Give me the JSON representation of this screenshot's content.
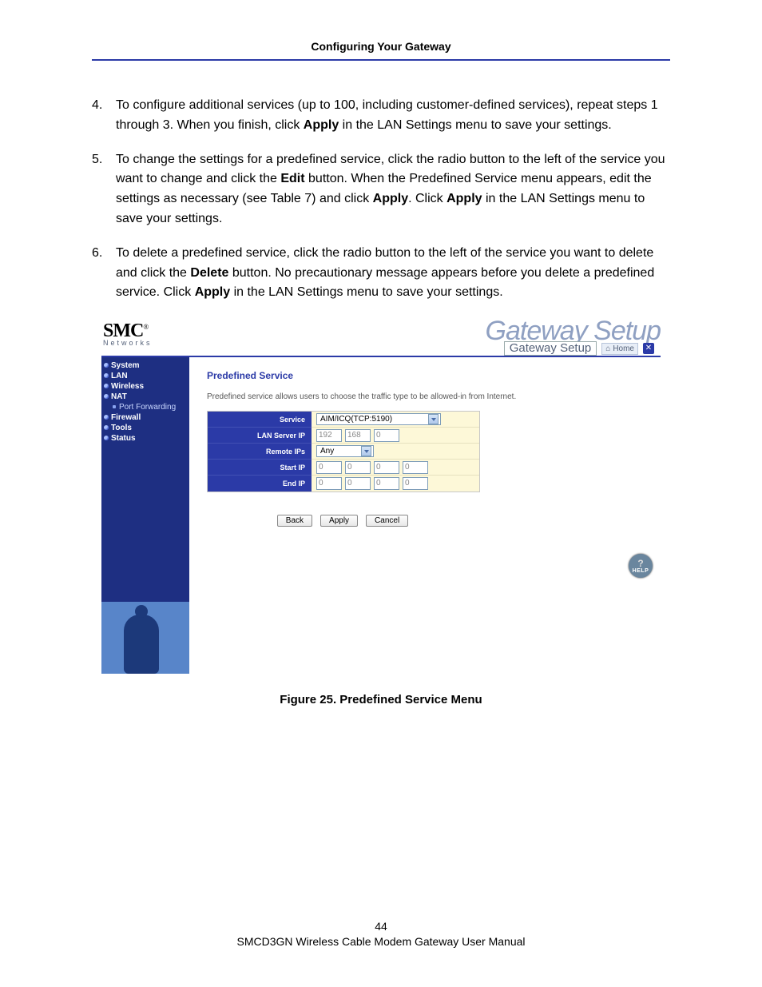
{
  "header": {
    "title": "Configuring Your Gateway"
  },
  "steps": {
    "s4": {
      "num": "4.",
      "text": "To configure additional services (up to 100, including customer-defined services), repeat steps 1 through 3. When you finish, click ",
      "b1": "Apply",
      "tail": " in the LAN Settings menu to save your settings."
    },
    "s5": {
      "num": "5.",
      "p1": "To change the settings for a predefined service, click the radio button to the left of the service you want to change and click the ",
      "b1": "Edit",
      "p2": " button. When the Predefined Service menu appears, edit the settings as necessary (see Table 7) and click ",
      "b2": "Apply",
      "p3": ". Click ",
      "b3": "Apply",
      "p4": " in the LAN Settings menu to save your settings."
    },
    "s6": {
      "num": "6.",
      "p1": "To delete a predefined service, click the radio button to the left of the service you want to delete and click the ",
      "b1": "Delete",
      "p2": " button. No precautionary message appears before you delete a predefined service. Click ",
      "b2": "Apply",
      "p3": " in the LAN Settings menu to save your settings."
    }
  },
  "figure_caption": "Figure 25. Predefined Service Menu",
  "footer": {
    "page": "44",
    "line": "SMCD3GN Wireless Cable Modem Gateway User Manual"
  },
  "shot": {
    "brand": {
      "name": "SMC",
      "sup": "®",
      "sub": "Networks"
    },
    "decor_title": "Gateway Setup",
    "bar_title": "Gateway Setup",
    "home": "Home",
    "sidebar": {
      "items": [
        "System",
        "LAN",
        "Wireless",
        "NAT"
      ],
      "sub": "Port Forwarding",
      "items2": [
        "Firewall",
        "Tools",
        "Status"
      ]
    },
    "main": {
      "heading": "Predefined Service",
      "desc": "Predefined service allows users to choose the traffic type to be allowed-in from Internet.",
      "rows": {
        "service": {
          "label": "Service",
          "value": "AIM/ICQ(TCP:5190)"
        },
        "lan": {
          "label": "LAN Server IP",
          "a": "192",
          "b": "168",
          "c": "0"
        },
        "remote": {
          "label": "Remote IPs",
          "value": "Any"
        },
        "start": {
          "label": "Start IP",
          "a": "0",
          "b": "0",
          "c": "0",
          "d": "0"
        },
        "end": {
          "label": "End IP",
          "a": "0",
          "b": "0",
          "c": "0",
          "d": "0"
        }
      },
      "buttons": {
        "back": "Back",
        "apply": "Apply",
        "cancel": "Cancel"
      },
      "help": "HELP"
    }
  }
}
